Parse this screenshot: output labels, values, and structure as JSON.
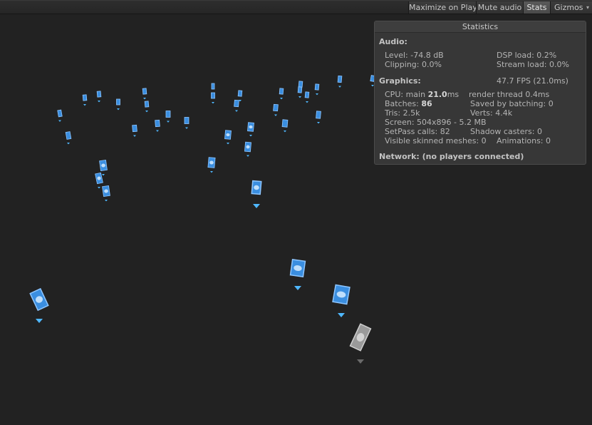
{
  "toolbar": {
    "buttons": [
      {
        "label": "Maximize on Play",
        "active": false
      },
      {
        "label": "Mute audio",
        "active": false
      },
      {
        "label": "Stats",
        "active": true
      },
      {
        "label": "Gizmos",
        "active": false
      }
    ],
    "gizmos_arrow": "▾"
  },
  "stats": {
    "title": "Statistics",
    "audio": {
      "header": "Audio:",
      "level": "Level: -74.8 dB",
      "clipping": "Clipping: 0.0%",
      "dsp_load": "DSP load: 0.2%",
      "stream_load": "Stream load: 0.0%"
    },
    "graphics": {
      "header": "Graphics:",
      "fps": "47.7 FPS (21.0ms)",
      "cpu_prefix": "CPU: main ",
      "cpu_main": "21.0",
      "cpu_suffix": "ms",
      "render_thread": "render thread 0.4ms",
      "batches_prefix": "Batches: ",
      "batches": "86",
      "saved_by_batching": "Saved by batching: 0",
      "tris": "Tris: 2.5k",
      "verts": "Verts: 4.4k",
      "screen": "Screen: 504x896 - 5.2 MB",
      "setpass": "SetPass calls: 82",
      "shadow_casters": "Shadow casters: 0",
      "skinned_meshes": "Visible skinned meshes: 0",
      "animations": "Animations: 0"
    },
    "network": "Network: (no players connected)"
  },
  "colors": {
    "background": "#222222",
    "card_blue": "#3a8ee0",
    "card_light": "#8ec6ff",
    "card_grey": "#9a9a9a",
    "panel_bg": "#383838"
  }
}
